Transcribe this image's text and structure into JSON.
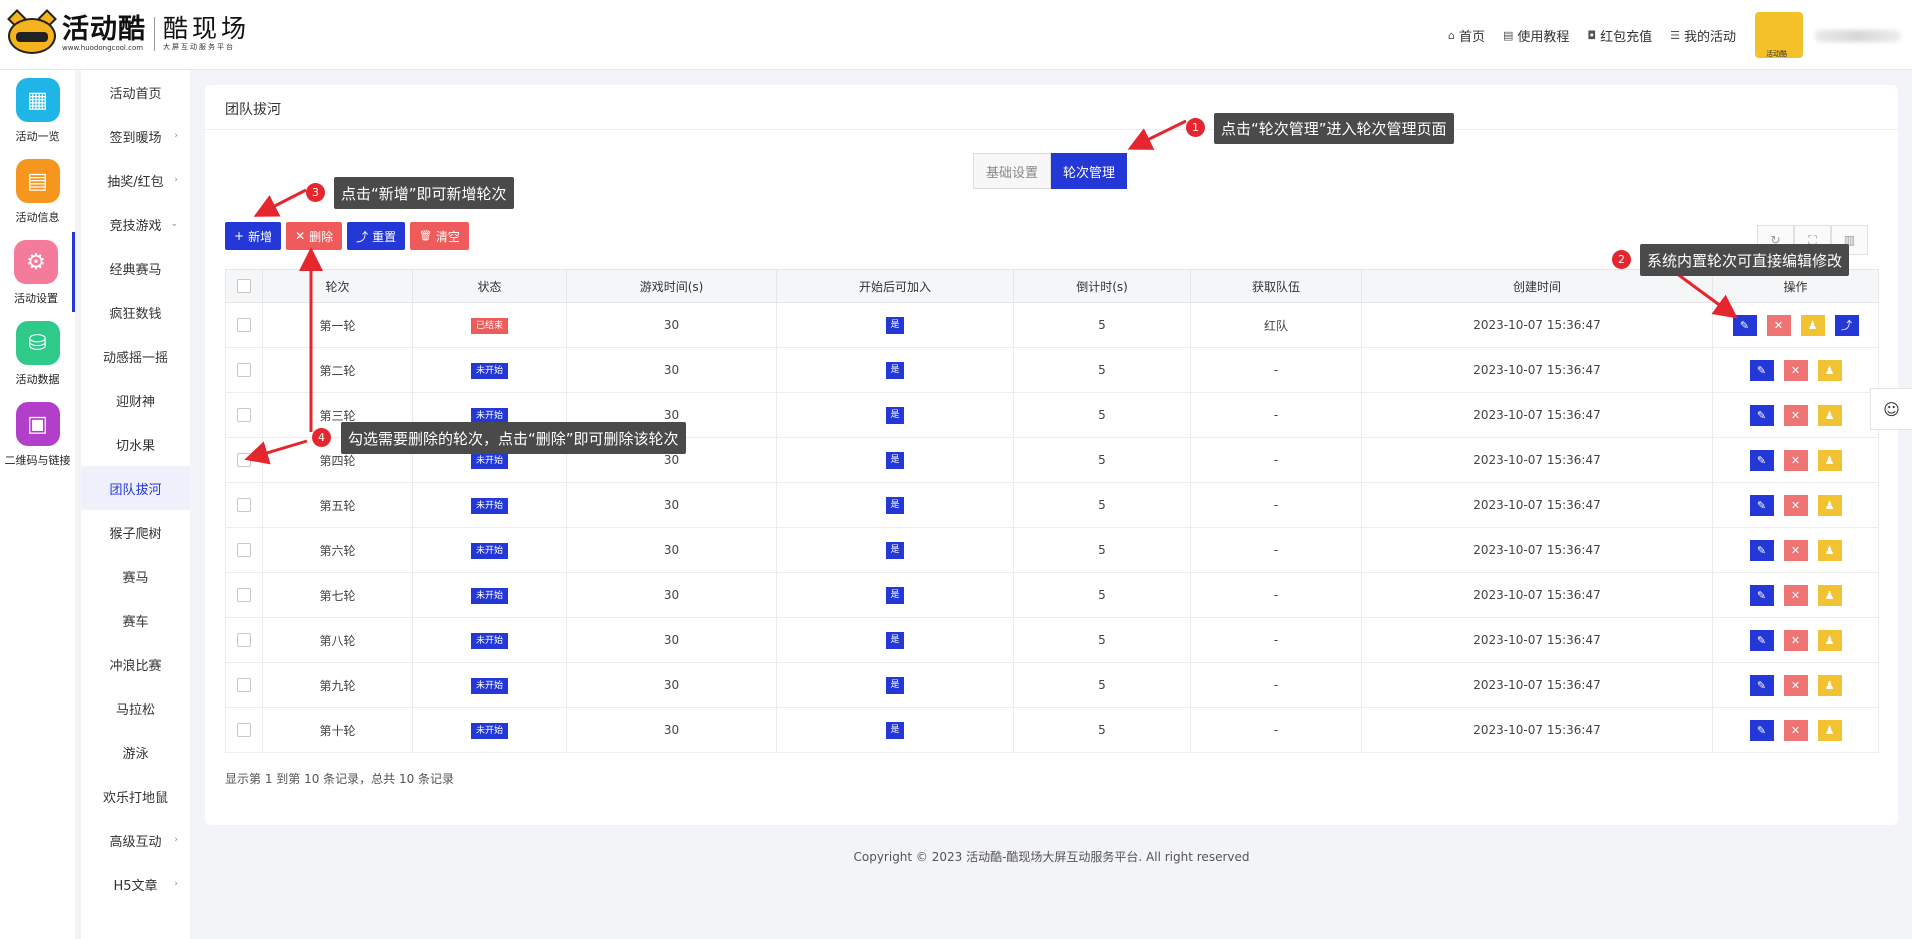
{
  "header": {
    "logo_text": "活动酷",
    "logo_url": "www.huodongcool.com",
    "brand_name": "酷现场",
    "brand_slogan": "大屏互动服务平台",
    "nav": [
      {
        "icon": "home-icon",
        "label": "首页"
      },
      {
        "icon": "document-icon",
        "label": "使用教程"
      },
      {
        "icon": "redpacket-icon",
        "label": "红包充值"
      },
      {
        "icon": "list-icon",
        "label": "我的活动"
      }
    ],
    "avatar_caption": "活动酷"
  },
  "icon_sidebar": [
    {
      "label": "活动一览",
      "icon": "grid-icon",
      "color": "#1fb5e6"
    },
    {
      "label": "活动信息",
      "icon": "document-icon",
      "color": "#f7961e"
    },
    {
      "label": "活动设置",
      "icon": "gear-icon",
      "color": "#f47b9a"
    },
    {
      "label": "活动数据",
      "icon": "database-icon",
      "color": "#2fc98a"
    },
    {
      "label": "二维码与链接",
      "icon": "qrcode-icon",
      "color": "#b23fc9"
    }
  ],
  "sub_sidebar": [
    {
      "label": "活动首页",
      "arrow": ""
    },
    {
      "label": "签到暖场",
      "arrow": "›"
    },
    {
      "label": "抽奖/红包",
      "arrow": "›"
    },
    {
      "label": "竞技游戏",
      "arrow": "⌄"
    },
    {
      "label": "经典赛马",
      "arrow": ""
    },
    {
      "label": "疯狂数钱",
      "arrow": ""
    },
    {
      "label": "动感摇一摇",
      "arrow": ""
    },
    {
      "label": "迎财神",
      "arrow": ""
    },
    {
      "label": "切水果",
      "arrow": ""
    },
    {
      "label": "团队拔河",
      "arrow": ""
    },
    {
      "label": "猴子爬树",
      "arrow": ""
    },
    {
      "label": "赛马",
      "arrow": ""
    },
    {
      "label": "赛车",
      "arrow": ""
    },
    {
      "label": "冲浪比赛",
      "arrow": ""
    },
    {
      "label": "马拉松",
      "arrow": ""
    },
    {
      "label": "游泳",
      "arrow": ""
    },
    {
      "label": "欢乐打地鼠",
      "arrow": ""
    },
    {
      "label": "高级互动",
      "arrow": "›"
    },
    {
      "label": "H5文章",
      "arrow": "›"
    }
  ],
  "card": {
    "title": "团队拔河",
    "tabs": [
      "基础设置",
      "轮次管理"
    ],
    "toolbar": [
      {
        "label": "新增",
        "icon": "plus-icon",
        "glyph": "+"
      },
      {
        "label": "删除",
        "icon": "close-icon",
        "glyph": "✕"
      },
      {
        "label": "重置",
        "icon": "reset-icon",
        "glyph": "⤴"
      },
      {
        "label": "清空",
        "icon": "trash-icon",
        "glyph": "🗑"
      }
    ],
    "right_tools": [
      "refresh-icon",
      "fullscreen-icon",
      "columns-icon"
    ],
    "table": {
      "columns": [
        "轮次",
        "状态",
        "游戏时间(s)",
        "开始后可加入",
        "倒计时(s)",
        "获取队伍",
        "创建时间",
        "操作"
      ],
      "rows": [
        {
          "round": "第一轮",
          "status": "已结束",
          "status_type": "red",
          "time": "30",
          "join": "是",
          "countdown": "5",
          "team": "红队",
          "created": "2023-10-07 15:36:47"
        },
        {
          "round": "第二轮",
          "status": "未开始",
          "status_type": "blue",
          "time": "30",
          "join": "是",
          "countdown": "5",
          "team": "-",
          "created": "2023-10-07 15:36:47"
        },
        {
          "round": "第三轮",
          "status": "未开始",
          "status_type": "blue",
          "time": "30",
          "join": "是",
          "countdown": "5",
          "team": "-",
          "created": "2023-10-07 15:36:47"
        },
        {
          "round": "第四轮",
          "status": "未开始",
          "status_type": "blue",
          "time": "30",
          "join": "是",
          "countdown": "5",
          "team": "-",
          "created": "2023-10-07 15:36:47"
        },
        {
          "round": "第五轮",
          "status": "未开始",
          "status_type": "blue",
          "time": "30",
          "join": "是",
          "countdown": "5",
          "team": "-",
          "created": "2023-10-07 15:36:47"
        },
        {
          "round": "第六轮",
          "status": "未开始",
          "status_type": "blue",
          "time": "30",
          "join": "是",
          "countdown": "5",
          "team": "-",
          "created": "2023-10-07 15:36:47"
        },
        {
          "round": "第七轮",
          "status": "未开始",
          "status_type": "blue",
          "time": "30",
          "join": "是",
          "countdown": "5",
          "team": "-",
          "created": "2023-10-07 15:36:47"
        },
        {
          "round": "第八轮",
          "status": "未开始",
          "status_type": "blue",
          "time": "30",
          "join": "是",
          "countdown": "5",
          "team": "-",
          "created": "2023-10-07 15:36:47"
        },
        {
          "round": "第九轮",
          "status": "未开始",
          "status_type": "blue",
          "time": "30",
          "join": "是",
          "countdown": "5",
          "team": "-",
          "created": "2023-10-07 15:36:47"
        },
        {
          "round": "第十轮",
          "status": "未开始",
          "status_type": "blue",
          "time": "30",
          "join": "是",
          "countdown": "5",
          "team": "-",
          "created": "2023-10-07 15:36:47"
        }
      ]
    },
    "summary": "显示第 1 到第 10 条记录，总共 10 条记录"
  },
  "footer": "Copyright © 2023 活动酷-酷现场大屏互动服务平台. All right reserved",
  "annotations": [
    {
      "num": "1",
      "text": "点击“轮次管理”进入轮次管理页面"
    },
    {
      "num": "2",
      "text": "系统内置轮次可直接编辑修改"
    },
    {
      "num": "3",
      "text": "点击“新增”即可新增轮次"
    },
    {
      "num": "4",
      "text": "勾选需要删除的轮次，点击“删除”即可删除该轮次"
    }
  ],
  "colors": {
    "primary": "#2438d8",
    "danger": "#ef5b5b",
    "warning": "#f1c232",
    "annotation": "#e6262e"
  }
}
